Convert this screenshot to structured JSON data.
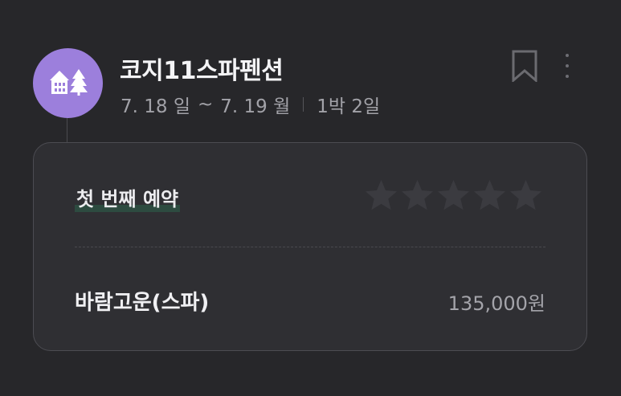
{
  "listing": {
    "name": "코지11스파펜션",
    "check_in": "7. 18 일",
    "date_separator": "~",
    "check_out": "7. 19 월",
    "stay_length": "1박 2일",
    "avatar_icon": "house-trees-icon",
    "avatar_color": "#9c7fdc"
  },
  "actions": {
    "bookmark_icon": "bookmark-icon",
    "more_icon": "more-vertical-icon"
  },
  "card": {
    "first_booking_label": "첫 번째 예약",
    "rating": {
      "max": 5,
      "value": 0,
      "star_icon": "star-icon"
    },
    "room_name": "바람고운(스파)",
    "price": "135,000원"
  }
}
